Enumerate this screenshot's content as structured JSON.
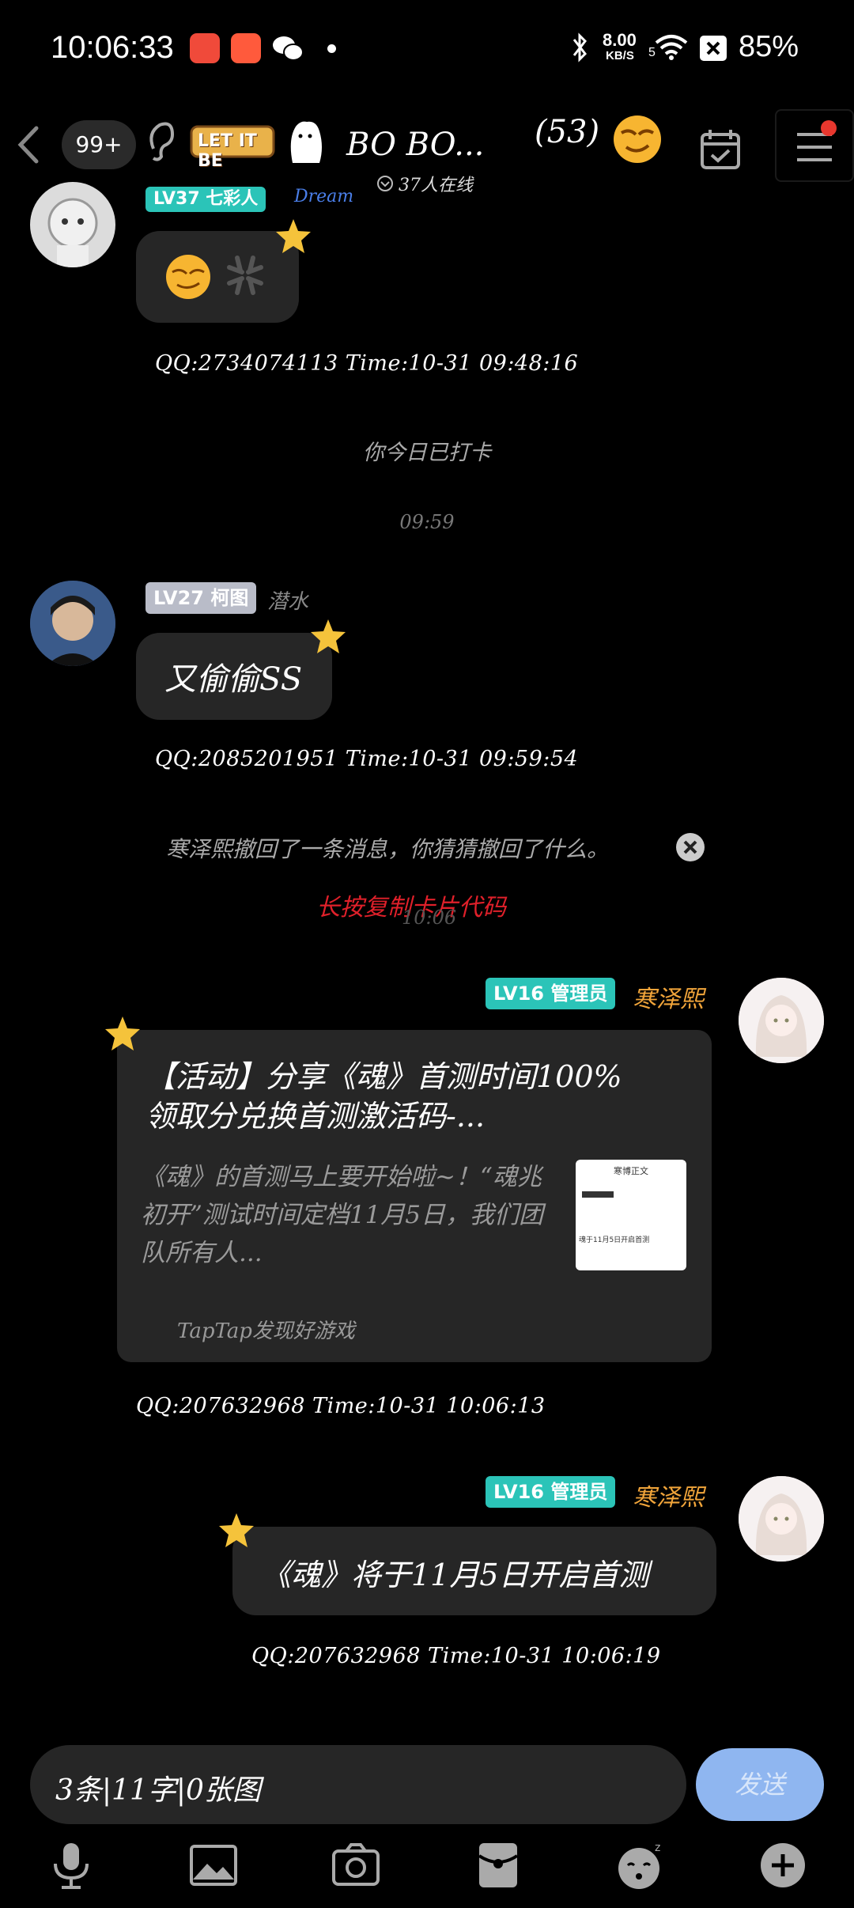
{
  "status_bar": {
    "time": "10:06:33",
    "net_speed_value": "8.00",
    "net_speed_unit": "KB/S",
    "signal_label": "5",
    "battery": "85%"
  },
  "header": {
    "unread": "99+",
    "sticker_text": "LET IT BE",
    "title": "BO BO...",
    "online": "37人在线",
    "count": "(53)"
  },
  "messages": {
    "m1": {
      "level_badge": "LV37 七彩人",
      "name_hint": "Dream",
      "meta": "QQ:2734074113 Time:10-31 09:48:16"
    },
    "checkin": "你今日已打卡",
    "time_0959": "09:59",
    "m2": {
      "level_badge": "LV27 柯图",
      "name": "潜水",
      "text": "又偷偷SS",
      "meta": "QQ:2085201951 Time:10-31 09:59:54"
    },
    "recall_notice": "寒泽熙撤回了一条消息，你猜猜撤回了什么。",
    "copy_hint": "长按复制卡片代码",
    "time_1006": "10:06",
    "m3": {
      "level_badge": "LV16 管理员",
      "name": "寒泽熙",
      "card_title": "【活动】分享《魂》首测时间100%领取分兑换首测激活码-...",
      "card_desc": "《魂》的首测马上要开始啦~！“魂兆初开”测试时间定档11月5日，我们团队所有人...",
      "card_source": "TapTap发现好游戏",
      "thumb_title": "寒博正文",
      "thumb_line": "魂于11月5日开启首测",
      "meta": "QQ:207632968 Time:10-31 10:06:13"
    },
    "m4": {
      "level_badge": "LV16 管理员",
      "name": "寒泽熙",
      "text": "《魂》将于11月5日开启首测",
      "meta": "QQ:207632968 Time:10-31 10:06:19"
    }
  },
  "input": {
    "value": "3条|11字|0张图",
    "send_label": "发送"
  },
  "colors": {
    "badge_teal": "#2bc4b8",
    "badge_gray": "#b9bcc8",
    "admin_name": "#f0a43a",
    "copy_hint": "#e0202a",
    "send": "#8fb6f0"
  }
}
